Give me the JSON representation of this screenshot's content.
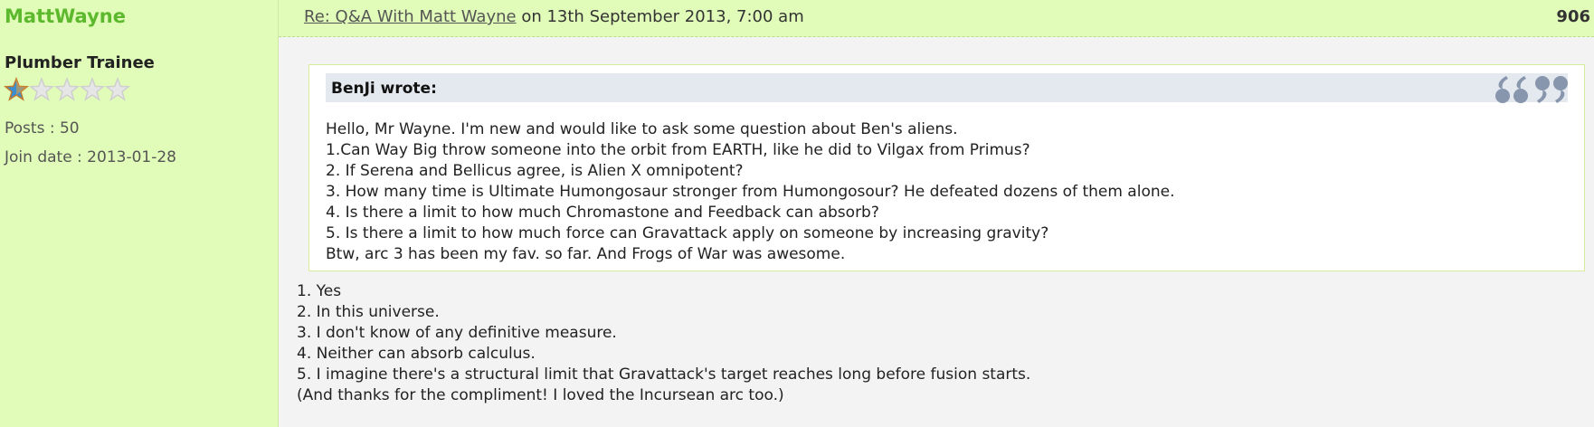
{
  "author": {
    "username": "MattWayne",
    "rank": "Plumber Trainee",
    "rating": {
      "filled": 1,
      "total": 5
    },
    "posts": "Posts : 50",
    "join_date": "Join date : 2013-01-28"
  },
  "post": {
    "title_link": "Re: Q&A With Matt Wayne",
    "title_suffix": " on 13th September 2013, 7:00 am",
    "number": "906"
  },
  "quote": {
    "author_label": "BenJi wrote:",
    "icon": "quote-icon",
    "lines": [
      "Hello, Mr Wayne. I'm new and would like to ask some question about Ben's aliens.",
      "1.Can Way Big throw someone into the orbit from EARTH, like he did to Vilgax from Primus?",
      "2. If Serena and Bellicus agree, is Alien X omnipotent?",
      "3. How many time is Ultimate Humongosaur stronger from Humongosour? He defeated dozens of them alone.",
      "4. Is there a limit to how much Chromastone and Feedback can absorb?",
      "5. Is there a limit to how much force can Gravattack apply on someone by increasing gravity?",
      "Btw, arc 3 has been my fav. so far. And Frogs of War was awesome."
    ]
  },
  "reply": {
    "lines": [
      "1. Yes",
      "2. In this universe.",
      "3. I don't know of any definitive measure.",
      "4. Neither can absorb calculus.",
      "5. I imagine there's a structural limit that Gravattack's target reaches long before fusion starts.",
      "(And thanks for the compliment! I loved the Incursean arc too.)"
    ]
  },
  "colors": {
    "sidebar_bg": "#e0fcb8",
    "username": "#5cb82c",
    "star_filled": "#3b8fd1",
    "star_empty": "#e4e4e4"
  }
}
